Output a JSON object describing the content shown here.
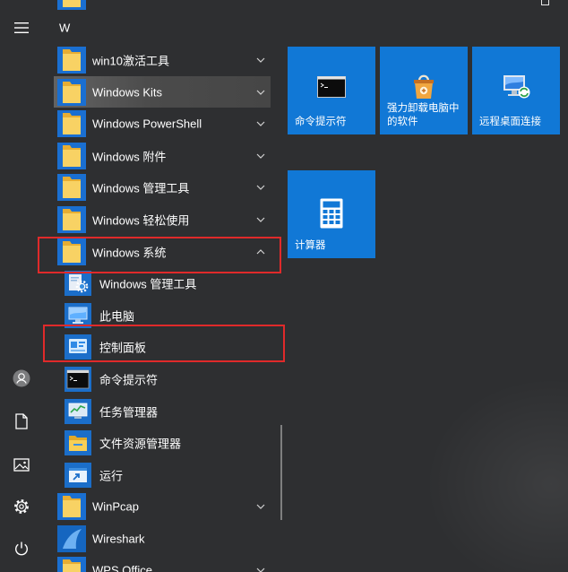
{
  "colors": {
    "background": "#2e2f31",
    "tile": "#1178d6",
    "hover": "#4b4b4b",
    "annotation": "#e02a2a",
    "text": "#ffffff"
  },
  "nav_rail": {
    "icons": [
      "hamburger-icon",
      "user-avatar-icon",
      "document-icon",
      "picture-icon",
      "gear-icon",
      "power-icon"
    ]
  },
  "app_list": {
    "section_letter": "W",
    "items": [
      {
        "label": "win10激活工具",
        "icon": "folder-icon",
        "chevron": "chevron-down-icon"
      },
      {
        "label": "Windows Kits",
        "icon": "folder-icon",
        "chevron": "chevron-down-icon",
        "hovered": true
      },
      {
        "label": "Windows PowerShell",
        "icon": "folder-icon",
        "chevron": "chevron-down-icon"
      },
      {
        "label": "Windows 附件",
        "icon": "folder-icon",
        "chevron": "chevron-down-icon"
      },
      {
        "label": "Windows 管理工具",
        "icon": "folder-icon",
        "chevron": "chevron-down-icon"
      },
      {
        "label": "Windows 轻松使用",
        "icon": "folder-icon",
        "chevron": "chevron-down-icon"
      },
      {
        "label": "Windows 系统",
        "icon": "folder-icon",
        "chevron": "chevron-up-icon",
        "expanded": true,
        "annotated": true,
        "children": [
          {
            "label": "Windows 管理工具",
            "icon": "admin-tools-icon"
          },
          {
            "label": "此电脑",
            "icon": "this-pc-icon"
          },
          {
            "label": "控制面板",
            "icon": "control-panel-icon",
            "annotated": true
          },
          {
            "label": "命令提示符",
            "icon": "command-prompt-icon"
          },
          {
            "label": "任务管理器",
            "icon": "task-manager-icon"
          },
          {
            "label": "文件资源管理器",
            "icon": "file-explorer-icon"
          },
          {
            "label": "运行",
            "icon": "run-icon"
          }
        ]
      },
      {
        "label": "WinPcap",
        "icon": "folder-icon",
        "chevron": "chevron-down-icon"
      },
      {
        "label": "Wireshark",
        "icon": "wireshark-icon"
      },
      {
        "label": "WPS Office",
        "icon": "folder-icon",
        "chevron": "chevron-down-icon"
      }
    ]
  },
  "tiles": [
    {
      "label_lines": [
        "命令提示符"
      ],
      "icon": "command-prompt-icon"
    },
    {
      "label_lines": [
        "强力卸载电脑中",
        "的软件"
      ],
      "icon": "uninstaller-package-icon"
    },
    {
      "label_lines": [
        "远程桌面连接"
      ],
      "icon": "remote-desktop-icon"
    },
    {
      "label_lines": [
        "计算器"
      ],
      "icon": "calculator-icon"
    }
  ]
}
